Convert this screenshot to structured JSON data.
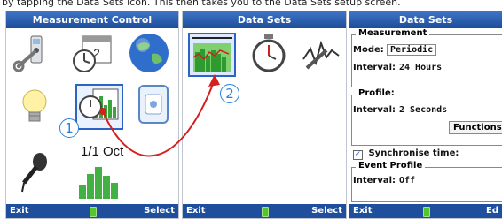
{
  "caption": "by tapping the Data Sets icon. This then takes you to the Data Sets setup screen.",
  "screen1": {
    "title": "Measurement Control",
    "calendar_text": "1/1 Oct",
    "status_left": "Exit",
    "status_right": "Select"
  },
  "screen2": {
    "title": "Data Sets",
    "status_left": "Exit",
    "status_right": "Select"
  },
  "screen3": {
    "title": "Data Sets",
    "measurement_header": "Measurement",
    "mode_label": "Mode:",
    "mode_value": "Periodic",
    "interval_label": "Interval:",
    "interval_value": "24 Hours",
    "profile_header": "Profile:",
    "profile_interval_label": "Interval:",
    "profile_interval_value": "2 Seconds",
    "functions_button": "Functions:",
    "sync_label": "Synchronise time:",
    "sync_checked": true,
    "event_header": "Event Profile",
    "event_interval_label": "Interval:",
    "event_interval_value": "Off",
    "status_left": "Exit",
    "status_right": "Ed"
  },
  "callouts": [
    "1",
    "2"
  ],
  "colors": {
    "title_blue": "#1d4d9a",
    "status_blue": "#1f4f9c",
    "callout_blue": "#2b83d8",
    "arrow_red": "#d61f1f",
    "battery_green": "#54c62b"
  }
}
